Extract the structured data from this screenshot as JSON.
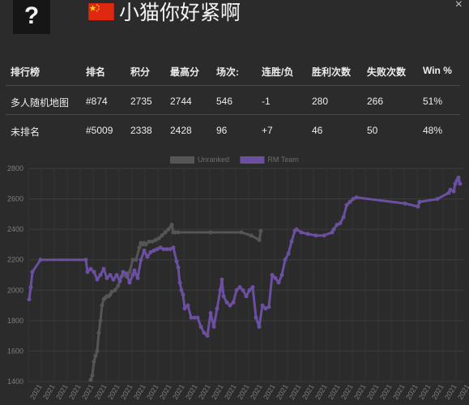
{
  "header": {
    "avatar_glyph": "?",
    "player_name": "小猫你好紧啊",
    "close_glyph": "×"
  },
  "stats_table": {
    "columns": [
      "排行榜",
      "排名",
      "积分",
      "最高分",
      "场次:",
      "连胜/负",
      "胜利次数",
      "失败次数",
      "Win %"
    ],
    "rows": [
      [
        "多人随机地图",
        "#874",
        "2735",
        "2744",
        "546",
        "-1",
        "280",
        "266",
        "51%"
      ],
      [
        "未排名",
        "#5009",
        "2338",
        "2428",
        "96",
        "+7",
        "46",
        "50",
        "48%"
      ]
    ]
  },
  "chart_data": {
    "type": "line",
    "ylim": [
      1400,
      2800
    ],
    "yticks": [
      1400,
      1600,
      1800,
      2000,
      2200,
      2400,
      2600,
      2800
    ],
    "x_tick_label": "2021",
    "legend": [
      {
        "name": "Unranked",
        "color": "#555555"
      },
      {
        "name": "RM Team",
        "color": "#6b4fa0"
      }
    ],
    "series": [
      {
        "name": "Unranked",
        "color": "#555555",
        "x": [
          112,
          114,
          116,
          118,
          120,
          122,
          124,
          126,
          128,
          130,
          132,
          134,
          136,
          138,
          142,
          146,
          150,
          154,
          156,
          158,
          160,
          164,
          168,
          172,
          174,
          176,
          178,
          180,
          184,
          188,
          192,
          196,
          200,
          204,
          208,
          212,
          214,
          216,
          220,
          260,
          298,
          310,
          320,
          322
        ],
        "values": [
          1410,
          1440,
          1530,
          1570,
          1600,
          1720,
          1800,
          1900,
          1940,
          1950,
          1960,
          1960,
          1970,
          1990,
          2000,
          2030,
          2090,
          2100,
          2090,
          2100,
          2120,
          2200,
          2200,
          2280,
          2310,
          2300,
          2310,
          2300,
          2320,
          2320,
          2330,
          2340,
          2360,
          2380,
          2400,
          2430,
          2380,
          2380,
          2380,
          2380,
          2380,
          2360,
          2330,
          2390
        ]
      },
      {
        "name": "RM Team",
        "color": "#6b4fa0",
        "x": [
          36,
          38,
          40,
          50,
          106,
          108,
          112,
          116,
          120,
          124,
          128,
          132,
          136,
          140,
          144,
          148,
          152,
          156,
          160,
          164,
          166,
          170,
          174,
          178,
          182,
          186,
          190,
          194,
          198,
          202,
          206,
          210,
          214,
          218,
          220,
          222,
          224,
          226,
          228,
          232,
          236,
          240,
          244,
          248,
          252,
          256,
          260,
          264,
          268,
          272,
          274,
          276,
          280,
          284,
          288,
          292,
          296,
          300,
          304,
          308,
          312,
          316,
          320,
          324,
          328,
          332,
          336,
          340,
          344,
          348,
          352,
          356,
          360,
          364,
          366,
          372,
          380,
          390,
          400,
          410,
          412,
          416,
          420,
          424,
          428,
          432,
          436,
          440,
          500,
          516,
          518,
          540,
          554,
          556,
          560,
          562,
          564,
          566,
          568
        ],
        "values": [
          1940,
          2020,
          2120,
          2200,
          2200,
          2120,
          2140,
          2120,
          2070,
          2100,
          2140,
          2080,
          2100,
          2070,
          2100,
          2060,
          2120,
          2110,
          2050,
          2100,
          2130,
          2080,
          2200,
          2260,
          2220,
          2250,
          2260,
          2270,
          2280,
          2270,
          2270,
          2270,
          2280,
          2190,
          2150,
          2050,
          2000,
          1970,
          1880,
          1900,
          1820,
          1820,
          1820,
          1760,
          1720,
          1700,
          1850,
          1760,
          1880,
          2000,
          2070,
          1960,
          1920,
          1900,
          1920,
          2000,
          2020,
          2000,
          1960,
          2000,
          2020,
          1820,
          1760,
          1900,
          1880,
          1890,
          2100,
          2080,
          2050,
          2100,
          2200,
          2240,
          2320,
          2390,
          2400,
          2380,
          2370,
          2360,
          2360,
          2380,
          2400,
          2430,
          2440,
          2480,
          2560,
          2580,
          2600,
          2610,
          2570,
          2550,
          2580,
          2600,
          2640,
          2660,
          2650,
          2700,
          2720,
          2740,
          2700
        ]
      }
    ]
  }
}
